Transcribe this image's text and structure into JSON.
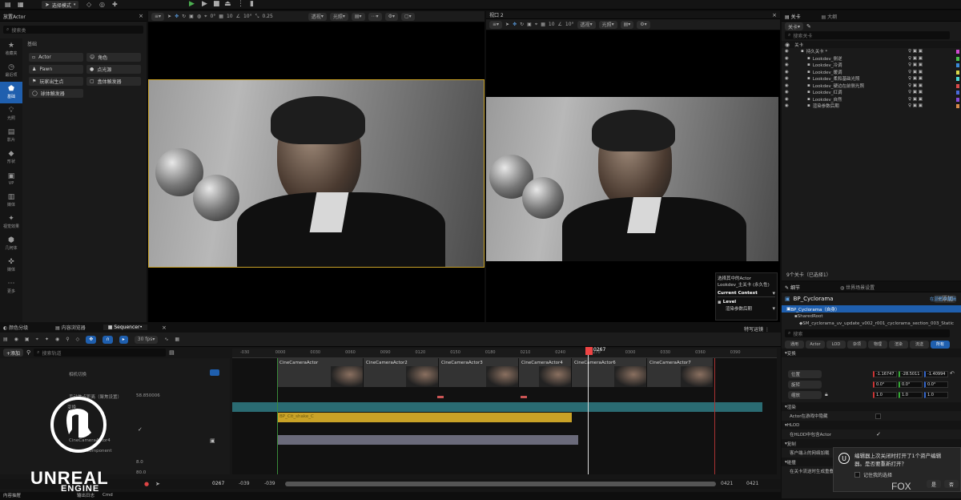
{
  "topbar": {
    "mode_label": "选择模式"
  },
  "place_actors": {
    "tab_title": "放置Actor",
    "search_placeholder": "搜索类",
    "section": "基础",
    "side_icons": [
      {
        "label": "收藏夹",
        "icon": "star-icon"
      },
      {
        "label": "最近项",
        "icon": "clock-icon"
      },
      {
        "label": "基础",
        "icon": "shapes-icon"
      },
      {
        "label": "光照",
        "icon": "light-icon"
      },
      {
        "label": "影片",
        "icon": "film-icon"
      },
      {
        "label": "形状",
        "icon": "cube-icon"
      },
      {
        "label": "VP",
        "icon": "camera-icon"
      },
      {
        "label": "媒体",
        "icon": "media-icon"
      },
      {
        "label": "视觉效果",
        "icon": "fx-icon"
      },
      {
        "label": "几何体",
        "icon": "geometry-icon"
      },
      {
        "label": "媒体",
        "icon": "media2-icon"
      },
      {
        "label": "更多",
        "icon": "more-icon"
      }
    ],
    "items": [
      "Actor",
      "角色",
      "Pawn",
      "点光源",
      "玩家出生点",
      "盒体触发器",
      "球体触发器"
    ]
  },
  "viewport1": {
    "view": "透视",
    "lit": "光照",
    "fov": "0°",
    "snap": "10",
    "rot": "10°",
    "scale": "0.25"
  },
  "viewport2": {
    "title": "视口 2",
    "view": "透视",
    "lit": "光照",
    "snap": "10",
    "rot": "10°",
    "scale": "0.25"
  },
  "context": {
    "line1": "选择其中的Actor",
    "line2": "Lookdev_主关卡 (永久性)",
    "current": "Current Context",
    "level": "Level",
    "level_sub": "渲染参数后期"
  },
  "outliner": {
    "tab1": "关卡",
    "tab2": "大纲",
    "levels_label": "关卡",
    "search_placeholder": "搜索关卡",
    "header": "关卡",
    "rows": [
      "持久关卡 *",
      "Lookdev_侧逆",
      "Lookdev_冷调",
      "Lookdev_暖调",
      "Lookdev_柔和基础光照",
      "Lookdev_硬边在前侧光照",
      "Lookdev_红调",
      "Lookdev_自然",
      "渲染参数后期"
    ],
    "footer": "9个关卡（已选择1）",
    "swatches": [
      "#d04ad0",
      "#4ac04a",
      "#3a8ad8",
      "#d8d84a",
      "#4ad8d8",
      "#d84a4a",
      "#4a6ad8",
      "#8a4ad8",
      "#d88a4a"
    ]
  },
  "details": {
    "tab1": "细节",
    "tab2": "世界场景设置",
    "object": "BP_Cyclorama",
    "add_btn": "+添加",
    "self_row": "BP_Cyclorama（自身）",
    "bp_link": "在蓝图中编辑",
    "shared_root": "SharedRoot",
    "mesh": "SM_cyclorama_uv_update_v002_r001_cyclorama_section_003_Static",
    "search_placeholder": "搜索",
    "filters": [
      "通用",
      "Actor",
      "LOD",
      "杂项",
      "物理",
      "渲染",
      "流送",
      "所有"
    ],
    "transform": "变换",
    "location": "位置",
    "rotation": "旋转",
    "scale": "缩放",
    "loc_vals": [
      "-1.16747",
      "-28.5011",
      "-1.40994"
    ],
    "rot_vals": [
      "0.0°",
      "0.0°",
      "0.0°"
    ],
    "scale_vals": [
      "1.0",
      "1.0",
      "1.0"
    ],
    "render": "渲染",
    "hidden": "Actor在游戏中隐藏",
    "hlod": "HLOD",
    "include_hlod": "在HLOD中包含Actor",
    "replication": "复制",
    "net_load": "客户端上的网络加载",
    "collision": "碰撞",
    "overlap": "在关卡流送时生成重叠事件"
  },
  "popup": {
    "line1": "编辑器上次关闭时打开了1个资产编辑",
    "line2": "器。是否要重新打开？",
    "remember": "记住我的选择",
    "yes": "是",
    "no": "否"
  },
  "sequencer": {
    "tabs": [
      "颜色分级",
      "内容浏览器",
      "Sequencer"
    ],
    "fps": "30 fps",
    "special": "特写运镜",
    "add": "+添加",
    "search_placeholder": "搜索轨道",
    "playhead": "0267",
    "current_frame": "0267",
    "range_start": "-039",
    "range_start2": "-039",
    "range_end": "0421",
    "range_end2": "0421",
    "ticks": [
      "-030",
      "0000",
      "0030",
      "0060",
      "0090",
      "0120",
      "0150",
      "0180",
      "0210",
      "0240",
      "0270",
      "0300",
      "0330",
      "0360",
      "0390"
    ],
    "tracks": [
      "相机切换",
      "手动焦点距离（聚焦设置）",
      "变换",
      "CameraComponent"
    ],
    "track_value": "58.850006",
    "vals": [
      "8.0",
      "80.0"
    ],
    "clips": [
      "CineCameraActor",
      "CineCameraActor2",
      "CineCameraActor3",
      "CineCameraActor4",
      "CineCameraActor6",
      "CineCameraActor7"
    ],
    "shake": "BP_Cit_shake_C",
    "cam4": "CineCameraActor4"
  },
  "bottom": {
    "tab1": "内容抽屉 ",
    "tab2": "输出日志",
    "cmd": "Cmd"
  },
  "watermark": "FOX",
  "logo": {
    "line1": "UNREAL",
    "line2": "ENGINE"
  }
}
